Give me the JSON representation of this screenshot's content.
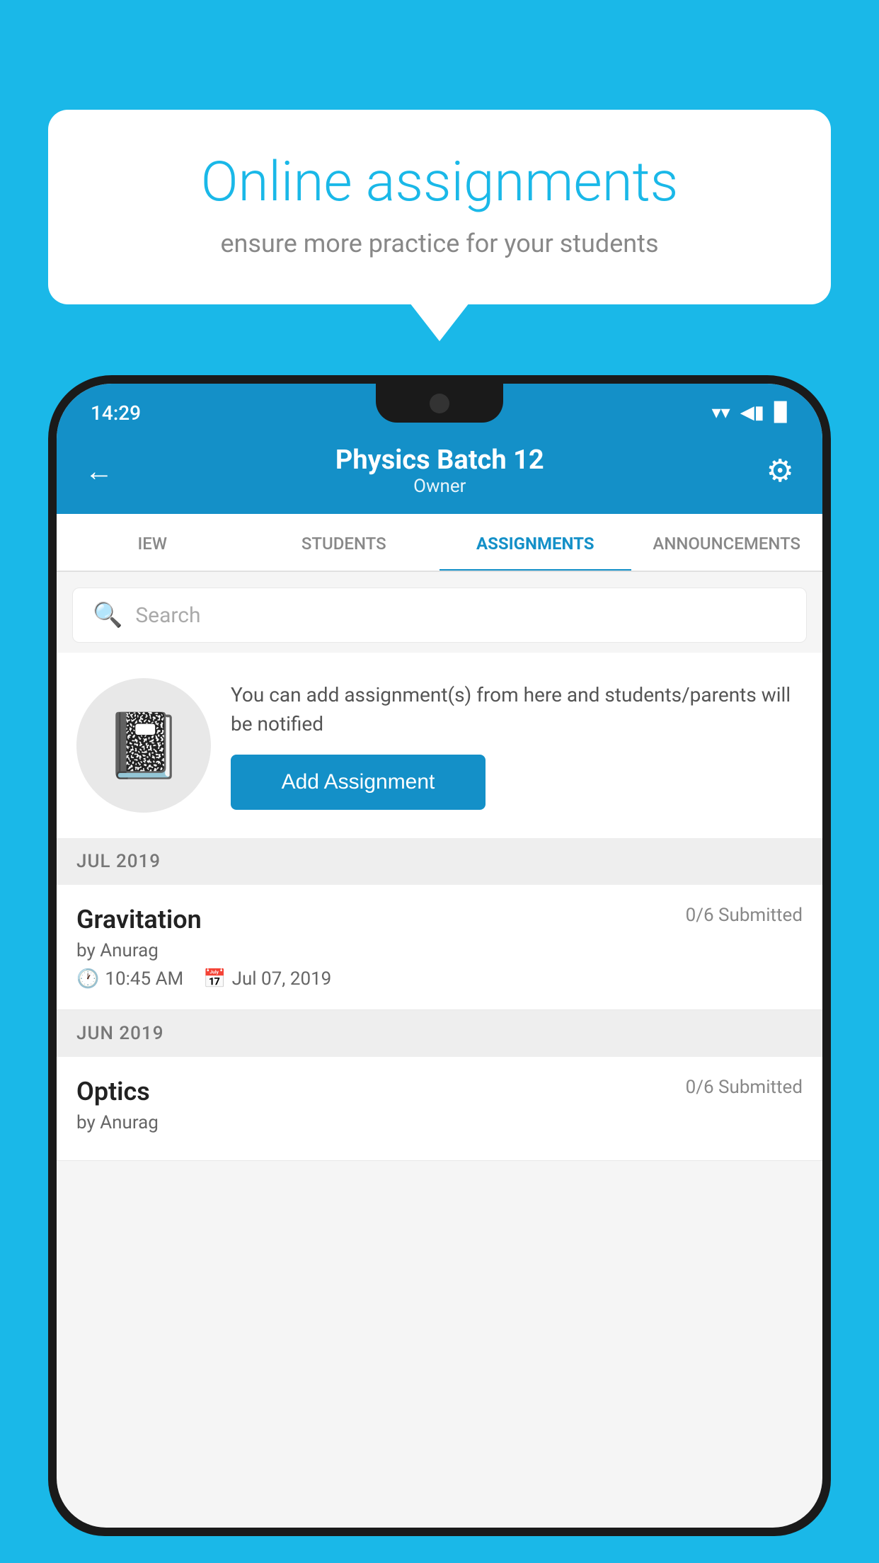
{
  "background_color": "#1ab8e8",
  "speech_bubble": {
    "title": "Online assignments",
    "subtitle": "ensure more practice for your students"
  },
  "phone": {
    "status_bar": {
      "time": "14:29",
      "wifi": "▲",
      "signal": "▲",
      "battery": "▉"
    },
    "header": {
      "title": "Physics Batch 12",
      "subtitle": "Owner",
      "back_label": "←",
      "gear_label": "⚙"
    },
    "tabs": [
      {
        "label": "IEW",
        "active": false
      },
      {
        "label": "STUDENTS",
        "active": false
      },
      {
        "label": "ASSIGNMENTS",
        "active": true
      },
      {
        "label": "ANNOUNCEMENTS",
        "active": false
      }
    ],
    "search": {
      "placeholder": "Search"
    },
    "promo": {
      "description": "You can add assignment(s) from here and students/parents will be notified",
      "button_label": "Add Assignment"
    },
    "assignments": [
      {
        "month": "JUL 2019",
        "items": [
          {
            "title": "Gravitation",
            "submitted": "0/6 Submitted",
            "by": "by Anurag",
            "time": "10:45 AM",
            "date": "Jul 07, 2019"
          }
        ]
      },
      {
        "month": "JUN 2019",
        "items": [
          {
            "title": "Optics",
            "submitted": "0/6 Submitted",
            "by": "by Anurag",
            "time": "",
            "date": ""
          }
        ]
      }
    ]
  }
}
